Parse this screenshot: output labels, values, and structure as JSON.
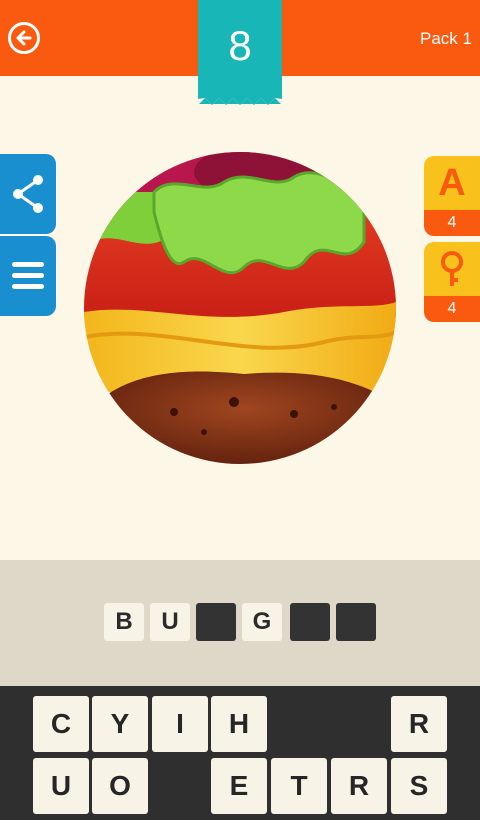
{
  "header": {
    "level": "8",
    "pack_label": "Pack 1",
    "back_icon": "back-arrow-icon"
  },
  "side_buttons": [
    {
      "icon": "share-icon"
    },
    {
      "icon": "menu-icon"
    }
  ],
  "hints": [
    {
      "letter": "A",
      "count": "4"
    },
    {
      "icon": "magnifier-icon",
      "count": "4"
    }
  ],
  "answer": {
    "slots": [
      "B",
      "U",
      "",
      "G",
      "",
      ""
    ]
  },
  "keyboard": {
    "row1": [
      "C",
      "Y",
      "I",
      "H",
      "",
      "",
      "R"
    ],
    "row2": [
      "U",
      "O",
      "",
      "E",
      "T",
      "R",
      "S"
    ]
  },
  "colors": {
    "header": "#fa5a0f",
    "banner": "#18b6b6",
    "side_buttons": "#1a8fd0",
    "hint": "#f9c11b",
    "background": "#fdf7e8"
  }
}
